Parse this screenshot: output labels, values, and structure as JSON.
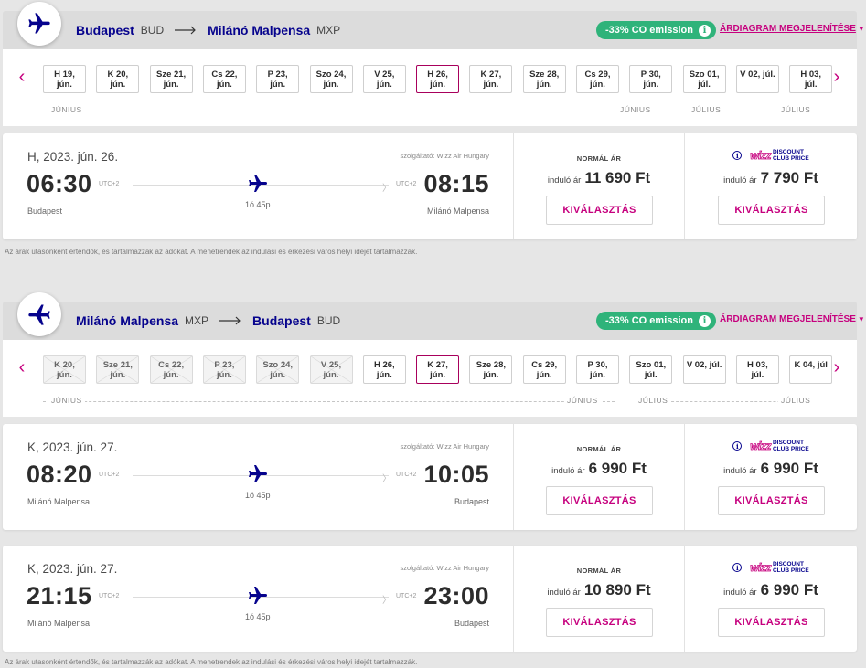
{
  "outbound": {
    "origin_city": "Budapest",
    "origin_code": "BUD",
    "destination_city": "Milánó Malpensa",
    "destination_code": "MXP",
    "co_emission": "-33% CO emission",
    "price_chart_link": "ÁRDIAGRAM MEGJELENÍTÉSE",
    "dates": [
      {
        "day": "H 19,",
        "month": "jún.",
        "state": "normal"
      },
      {
        "day": "K 20,",
        "month": "jún.",
        "state": "normal"
      },
      {
        "day": "Sze 21,",
        "month": "jún.",
        "state": "normal"
      },
      {
        "day": "Cs 22,",
        "month": "jún.",
        "state": "normal"
      },
      {
        "day": "P 23,",
        "month": "jún.",
        "state": "normal"
      },
      {
        "day": "Szo 24,",
        "month": "jún.",
        "state": "normal"
      },
      {
        "day": "V 25,",
        "month": "jún.",
        "state": "normal"
      },
      {
        "day": "H 26,",
        "month": "jún.",
        "state": "selected"
      },
      {
        "day": "K 27,",
        "month": "jún.",
        "state": "normal"
      },
      {
        "day": "Sze 28,",
        "month": "jún.",
        "state": "normal"
      },
      {
        "day": "Cs 29,",
        "month": "jún.",
        "state": "normal"
      },
      {
        "day": "P 30,",
        "month": "jún.",
        "state": "normal"
      },
      {
        "day": "Szo 01,",
        "month": "júl.",
        "state": "normal"
      },
      {
        "day": "V 02, júl.",
        "month": "",
        "state": "normal"
      },
      {
        "day": "H 03,",
        "month": "júl.",
        "state": "normal"
      }
    ],
    "month_june": "JÚNIUS",
    "month_june_end": "JÚNIUS",
    "month_july": "JÚLIUS",
    "month_july_end": "JÚLIUS"
  },
  "outbound_flights": [
    {
      "date": "H, 2023. jún. 26.",
      "operator": "szolgáltató: Wizz Air Hungary",
      "dep_time": "06:30",
      "arr_time": "08:15",
      "tz": "UTC+2",
      "dep_city": "Budapest",
      "arr_city": "Milánó Malpensa",
      "duration": "1ó 45p",
      "normal_label": "NORMÁL ÁR",
      "from_label": "induló ár",
      "normal_price": "11 690 Ft",
      "club_price": "7 790 Ft",
      "select_label": "KIVÁLASZTÁS"
    }
  ],
  "disclaimer": "Az árak utasonként értendők, és tartalmazzák az adókat. A menetrendek az indulási és érkezési város helyi idejét tartalmazzák.",
  "wizz_logo": {
    "word": "wizz",
    "line1": "DISCOUNT",
    "line2": "CLUB PRICE"
  },
  "return": {
    "origin_city": "Milánó Malpensa",
    "origin_code": "MXP",
    "destination_city": "Budapest",
    "destination_code": "BUD",
    "co_emission": "-33% CO emission",
    "price_chart_link": "ÁRDIAGRAM MEGJELENÍTÉSE",
    "dates": [
      {
        "day": "K 20,",
        "month": "jún.",
        "state": "disabled"
      },
      {
        "day": "Sze 21,",
        "month": "jún.",
        "state": "disabled"
      },
      {
        "day": "Cs 22,",
        "month": "jún.",
        "state": "disabled"
      },
      {
        "day": "P 23,",
        "month": "jún.",
        "state": "disabled"
      },
      {
        "day": "Szo 24,",
        "month": "jún.",
        "state": "disabled"
      },
      {
        "day": "V 25,",
        "month": "jún.",
        "state": "disabled"
      },
      {
        "day": "H 26,",
        "month": "jún.",
        "state": "normal"
      },
      {
        "day": "K 27,",
        "month": "jún.",
        "state": "selected"
      },
      {
        "day": "Sze 28,",
        "month": "jún.",
        "state": "normal"
      },
      {
        "day": "Cs 29,",
        "month": "jún.",
        "state": "normal"
      },
      {
        "day": "P 30,",
        "month": "jún.",
        "state": "normal"
      },
      {
        "day": "Szo 01,",
        "month": "júl.",
        "state": "normal"
      },
      {
        "day": "V 02, júl.",
        "month": "",
        "state": "normal"
      },
      {
        "day": "H 03,",
        "month": "júl.",
        "state": "normal"
      },
      {
        "day": "K 04, júl",
        "month": "",
        "state": "normal"
      }
    ],
    "month_june": "JÚNIUS",
    "month_june_end": "JÚNIUS",
    "month_july": "JÚLIUS",
    "month_july_end": "JÚLIUS"
  },
  "return_flights": [
    {
      "date": "K, 2023. jún. 27.",
      "operator": "szolgáltató: Wizz Air Hungary",
      "dep_time": "08:20",
      "arr_time": "10:05",
      "tz": "UTC+2",
      "dep_city": "Milánó Malpensa",
      "arr_city": "Budapest",
      "duration": "1ó 45p",
      "normal_label": "NORMÁL ÁR",
      "from_label": "induló ár",
      "normal_price": "6 990 Ft",
      "club_price": "6 990 Ft",
      "select_label": "KIVÁLASZTÁS"
    },
    {
      "date": "K, 2023. jún. 27.",
      "operator": "szolgáltató: Wizz Air Hungary",
      "dep_time": "21:15",
      "arr_time": "23:00",
      "tz": "UTC+2",
      "dep_city": "Milánó Malpensa",
      "arr_city": "Budapest",
      "duration": "1ó 45p",
      "normal_label": "NORMÁL ÁR",
      "from_label": "induló ár",
      "normal_price": "10 890 Ft",
      "club_price": "6 990 Ft",
      "select_label": "KIVÁLASZTÁS"
    }
  ],
  "colors": {
    "brand_navy": "#06038d",
    "brand_magenta": "#c6007e",
    "co_green": "#2fb37a"
  },
  "icons": {
    "plane": "plane-icon",
    "info": "info-icon",
    "prev": "chevron-left-icon",
    "next": "chevron-right-icon",
    "arrow": "long-arrow-right-icon"
  }
}
